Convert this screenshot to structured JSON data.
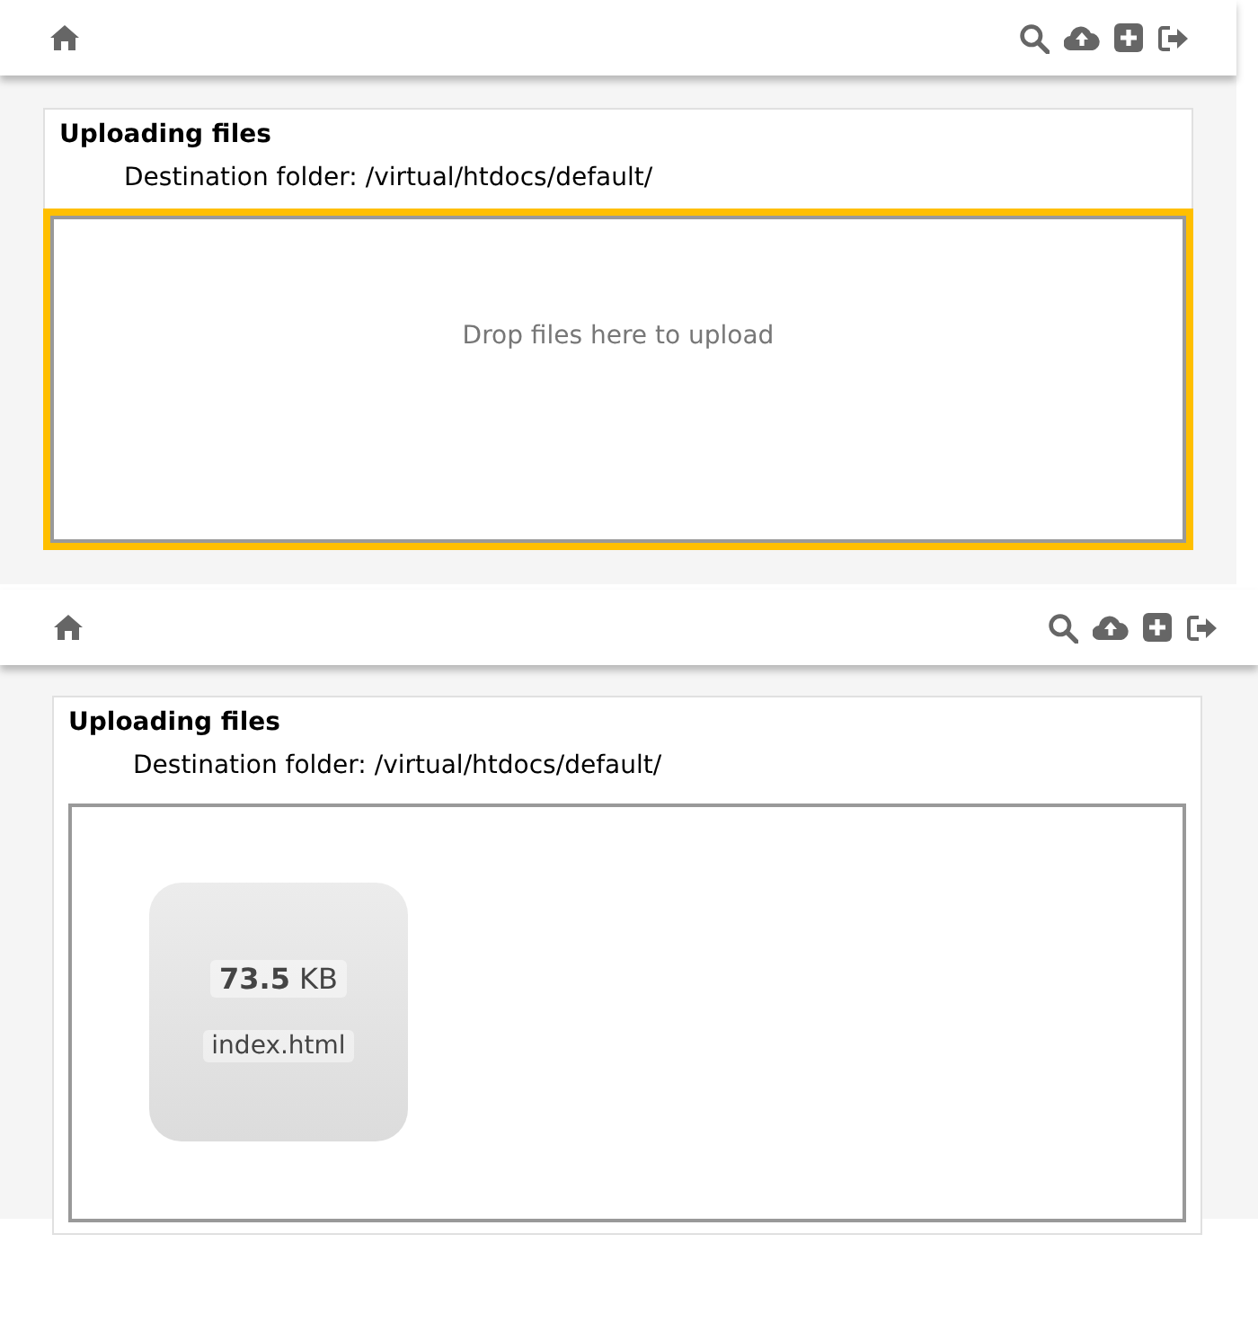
{
  "panels": [
    {
      "title": "Uploading files",
      "destination": "Destination folder: /virtual/htdocs/default/",
      "dropzone": {
        "highlighted": true,
        "message": "Drop files here to upload"
      }
    },
    {
      "title": "Uploading files",
      "destination": "Destination folder: /virtual/htdocs/default/",
      "dropzone": {
        "highlighted": false,
        "files": [
          {
            "size": "**73.5** KB",
            "name": "index.html"
          }
        ]
      }
    }
  ]
}
